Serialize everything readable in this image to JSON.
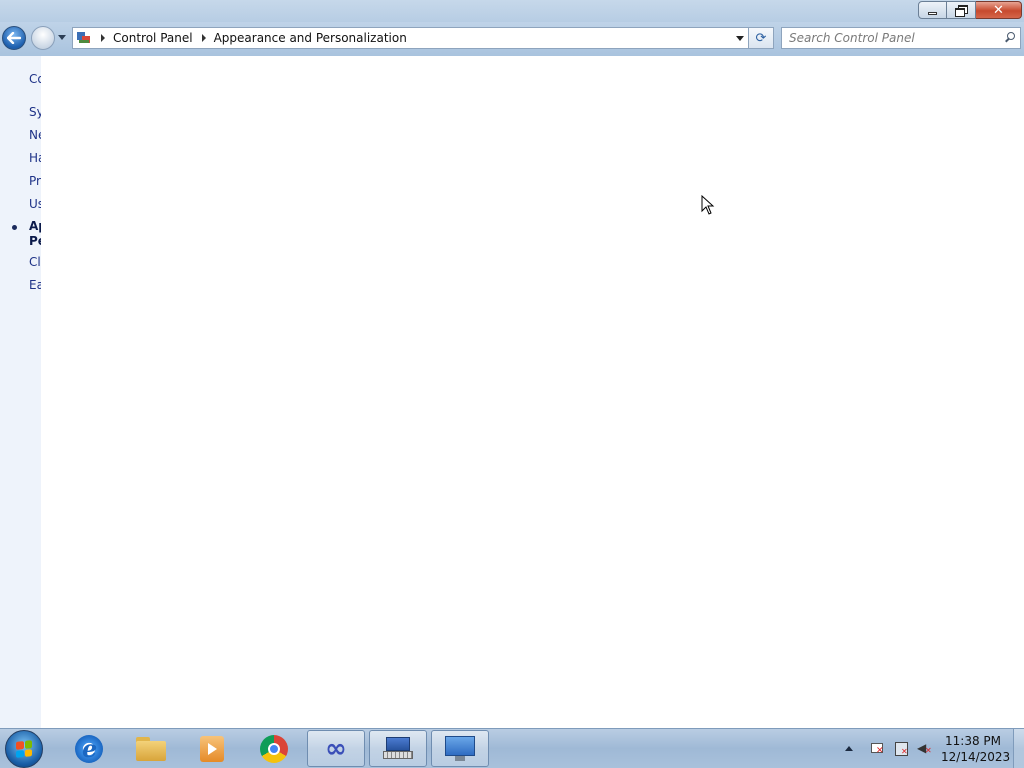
{
  "window": {
    "minimize_icon": "minimize-icon",
    "restore_icon": "restore-icon",
    "close_icon": "close-icon",
    "close_glyph": "✕"
  },
  "navigation": {
    "back_icon": "back-arrow-icon",
    "forward_icon": "forward-arrow-icon",
    "breadcrumbs": [
      "Control Panel",
      "Appearance and Personalization"
    ],
    "refresh_glyph": "⟳",
    "search_placeholder": "Search Control Panel",
    "search_value": ""
  },
  "left_pane": {
    "home": "Co",
    "items": [
      {
        "label": "Sy"
      },
      {
        "label": "Ne"
      },
      {
        "label": "Ha"
      },
      {
        "label": "Pr"
      },
      {
        "label": "Us"
      },
      {
        "label_line1": "Ap",
        "label_line2": "Pe",
        "current": true
      },
      {
        "label": "Cl"
      },
      {
        "label": "Ea"
      }
    ]
  },
  "taskbar": {
    "start_icon": "windows-start-orb",
    "pinned": [
      {
        "name": "internet-explorer-icon"
      },
      {
        "name": "windows-explorer-icon"
      },
      {
        "name": "media-player-icon"
      },
      {
        "name": "chrome-icon"
      },
      {
        "name": "infinity-app-icon",
        "glyph": "∞"
      },
      {
        "name": "onscreen-keyboard-icon"
      },
      {
        "name": "control-panel-icon"
      }
    ],
    "clock": {
      "time": "11:38 PM",
      "date": "12/14/2023"
    }
  },
  "colors": {
    "accent": "#1e3287",
    "titlebar": "#c6d8ea",
    "left_pane_bg": "#eef3fb",
    "close_button": "#c74a2e"
  }
}
